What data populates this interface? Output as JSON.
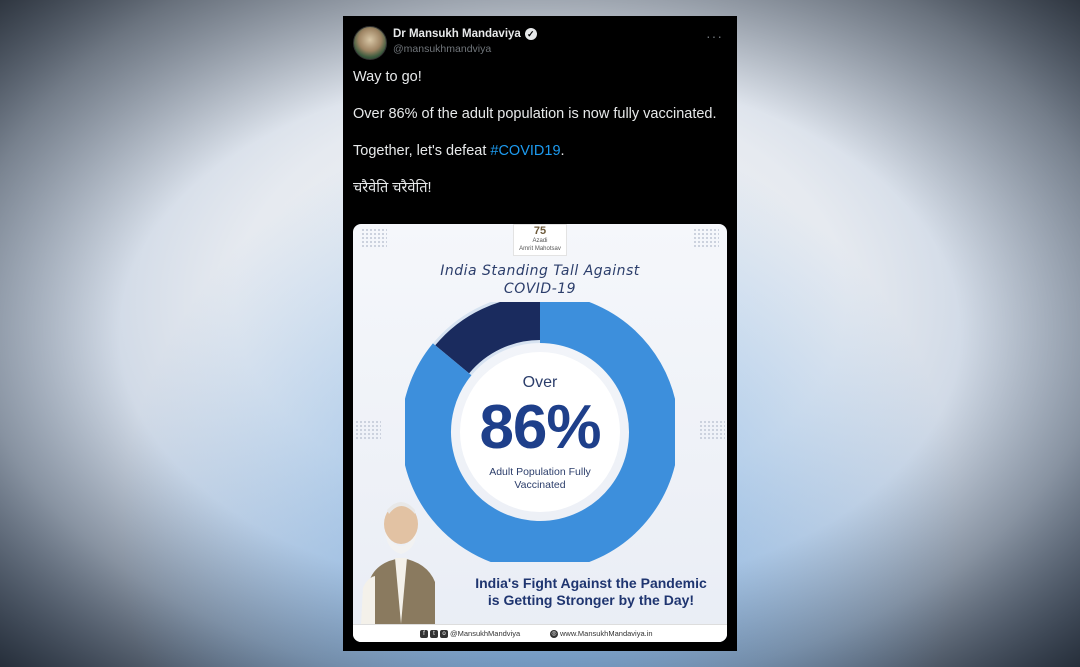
{
  "tweet": {
    "author_name": "Dr Mansukh Mandaviya",
    "handle": "@mansukhmandviya",
    "verified_icon": "verified-badge-icon",
    "more_icon": "more-options-icon",
    "more_glyph": "···",
    "lines": {
      "l1": "Way to go!",
      "l2": "Over 86% of the adult population is now fully vaccinated.",
      "l3_prefix": "Together, let's defeat ",
      "l3_hashtag": "#COVID19",
      "l3_suffix": ".",
      "l4": "चरैवेति चरैवेति!"
    },
    "hashtag_color": "#1d9bf0"
  },
  "media": {
    "logo_top": "75",
    "logo_line1": "Azadi",
    "logo_line2": "Ka",
    "logo_line3": "Amrit Mahotsav",
    "title_line1": "India Standing Tall Against",
    "title_line2": "COVID-19",
    "over_label": "Over",
    "percent_label": "86%",
    "percent_value": 86,
    "caption_line1": "Adult Population Fully",
    "caption_line2": "Vaccinated",
    "tagline_line1": "India's Fight Against the Pandemic",
    "tagline_line2": "is Getting Stronger by the Day!",
    "footer_social": "@MansukhMandviya",
    "footer_web": "www.MansukhMandaviya.in",
    "colors": {
      "donut_fill": "#3d8fdc",
      "donut_remaining": "#1a2b5e",
      "title": "#2c3e6b",
      "big_number": "#1e3f8a"
    }
  }
}
